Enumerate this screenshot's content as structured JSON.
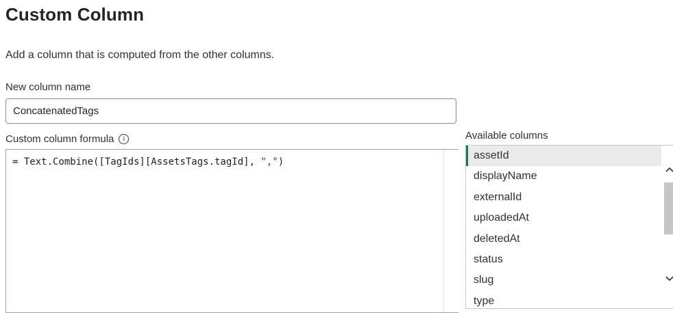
{
  "dialog": {
    "title": "Custom Column",
    "description": "Add a column that is computed from the other columns."
  },
  "new_column": {
    "label": "New column name",
    "value": "ConcatenatedTags"
  },
  "formula": {
    "label": "Custom column formula",
    "info_icon": "ⓘ",
    "code_prefix": "= Text.Combine([TagIds][AssetsTags.tagId], ",
    "code_string": "\",\"",
    "code_suffix": ")",
    "string_color": "#a31515"
  },
  "available_columns": {
    "label": "Available columns",
    "items": [
      {
        "label": "assetId",
        "selected": true
      },
      {
        "label": "displayName"
      },
      {
        "label": "externalId"
      },
      {
        "label": "uploadedAt"
      },
      {
        "label": "deletedAt"
      },
      {
        "label": "status"
      },
      {
        "label": "slug"
      },
      {
        "label": "type"
      }
    ],
    "selection_accent": "#117865"
  },
  "scrollbar": {
    "up_icon": "chevron-up-icon",
    "down_icon": "chevron-down-icon"
  }
}
